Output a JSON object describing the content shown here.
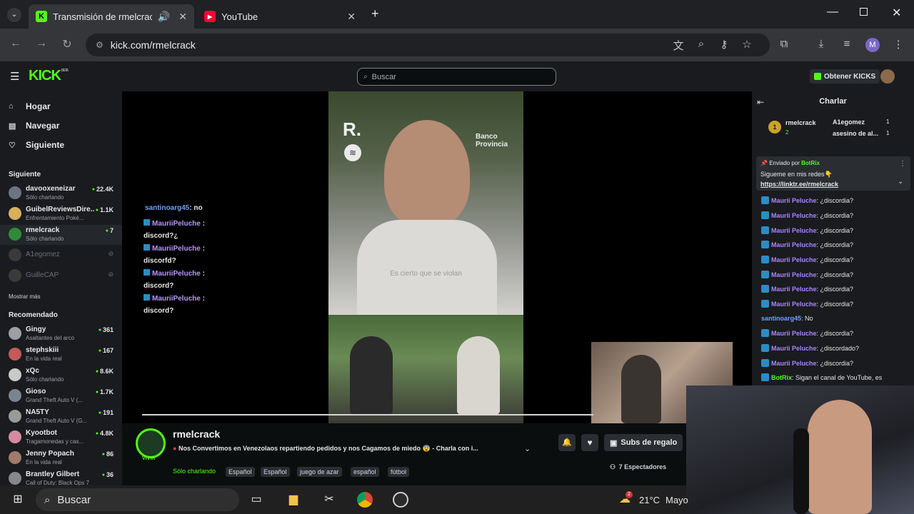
{
  "browser": {
    "tabs": [
      {
        "title": "Transmisión de rmelcrack: n",
        "active": true
      },
      {
        "title": "YouTube",
        "active": false
      }
    ],
    "url": "kick.com/rmelcrack",
    "profile_initial": "M"
  },
  "kick": {
    "logo": "KICK",
    "logo_tag": "BETA",
    "search_placeholder": "Buscar",
    "get_kicks_label": "Obtener KICKS",
    "nav": [
      {
        "label": "Hogar",
        "icon": "home-icon"
      },
      {
        "label": "Navegar",
        "icon": "browse-icon"
      },
      {
        "label": "Siguiente",
        "icon": "heart-icon"
      }
    ],
    "following_header": "Siguiente",
    "following": [
      {
        "name": "davooxeneizar",
        "sub": "Sólo charlando",
        "viewers": "22.4K",
        "color": "#6b7480"
      },
      {
        "name": "GuibelReviewsDire...",
        "sub": "Enfrentamiento Poké...",
        "viewers": "1.1K",
        "color": "#d7b15a"
      },
      {
        "name": "rmelcrack",
        "sub": "Sólo charlando",
        "viewers": "7",
        "color": "#2f8a3a"
      },
      {
        "name": "A1egomez",
        "sub": "",
        "viewers": "",
        "color": "#3a3a3a"
      },
      {
        "name": "GuilleCAP",
        "sub": "",
        "viewers": "",
        "color": "#3a3a3a"
      }
    ],
    "show_more": "Mostrar más",
    "recommended_header": "Recomendado",
    "recommended": [
      {
        "name": "Gingy",
        "sub": "Asaltantes del arco",
        "viewers": "361",
        "color": "#9aa0a6"
      },
      {
        "name": "stephskiii",
        "sub": "En la vida real",
        "viewers": "167",
        "color": "#c45a5a"
      },
      {
        "name": "xQc",
        "sub": "Sólo charlando",
        "viewers": "8.6K",
        "color": "#c9c9c9"
      },
      {
        "name": "Gioso",
        "sub": "Grand Theft Auto V (...",
        "viewers": "1.7K",
        "color": "#7a8590"
      },
      {
        "name": "NA5TY",
        "sub": "Grand Theft Auto V (G...",
        "viewers": "191",
        "color": "#9a9a9a"
      },
      {
        "name": "Kyootbot",
        "sub": "Tragamonedas y cas...",
        "viewers": "4.8K",
        "color": "#d48aa0"
      },
      {
        "name": "Jenny Popach",
        "sub": "En la vida real",
        "viewers": "86",
        "color": "#a07a6a"
      },
      {
        "name": "Brantley Gilbert",
        "sub": "Call of Duty: Black Ops 7",
        "viewers": "36",
        "color": "#888888"
      }
    ],
    "overlay_chat": [
      {
        "user": "santinoarg45",
        "text": ": no"
      },
      {
        "user": "MauriiPeluche",
        "text": " :",
        "line2": "discord?¿"
      },
      {
        "user": "MauriiPeluche",
        "text": " :",
        "line2": "discorfd?"
      },
      {
        "user": "MauriiPeluche",
        "text": " :",
        "line2": "discord?"
      },
      {
        "user": "MauriiPeluche",
        "text": " :",
        "line2": "discord?"
      }
    ],
    "video_caption": "Es cierto que se violan",
    "video_watermark": "R.",
    "video_sponsor": "Banco Provincia",
    "stream": {
      "channel": "rmelcrack",
      "live_badge": "VIVIR",
      "title": "Nos Convertimos en Venezolaos repartiendo pedidos y nos Cagamos de miedo 😨 - Charla con i...",
      "category": "Sólo charlando",
      "tags": [
        "Español",
        "Español",
        "juego de azar",
        "español",
        "fútbol"
      ],
      "gift_subs_label": "Subs de regalo",
      "viewers_label": "7 Espectadores"
    },
    "chat": {
      "title": "Charlar",
      "leaderboard": [
        {
          "name": "rmelcrack",
          "count": "2",
          "rank": "1"
        },
        {
          "name": "A1egomez",
          "count": "1"
        },
        {
          "name": "asesino de al...",
          "count": "1"
        }
      ],
      "pinned_by": "Enviado por",
      "pinned_user": "BotRix",
      "pinned_text": "Sigueme en mis redes👇",
      "pinned_link": "https://linktr.ee/rmelcrack",
      "messages": [
        {
          "user": "Maurii Peluche",
          "text": ": ¿discordia?"
        },
        {
          "user": "Maurii Peluche",
          "text": ": ¿discordia?"
        },
        {
          "user": "Maurii Peluche",
          "text": ": ¿discordia?"
        },
        {
          "user": "Maurii Peluche",
          "text": ": ¿discordia?"
        },
        {
          "user": "Maurii Peluche",
          "text": ": ¿discordia?"
        },
        {
          "user": "Maurii Peluche",
          "text": ": ¿discordia?"
        },
        {
          "user": "Maurii Peluche",
          "text": ": ¿discordia?"
        },
        {
          "user": "Maurii Peluche",
          "text": ": ¿discordia?"
        },
        {
          "user": "santinoarg45",
          "text": ": No"
        },
        {
          "user": "Maurii Peluche",
          "text": ": ¿discordia?"
        },
        {
          "user": "Maurii Peluche",
          "text": ": ¿discordado?"
        },
        {
          "user": "Maurii Peluche",
          "text": ": ¿discordia?"
        },
        {
          "user": "BotRix",
          "text": ": Sigan el canal de YouTube, es"
        }
      ]
    }
  },
  "taskbar": {
    "search_label": "Buscar",
    "weather_temp": "21°C",
    "weather_text": "Mayo",
    "notif_count": "2"
  }
}
